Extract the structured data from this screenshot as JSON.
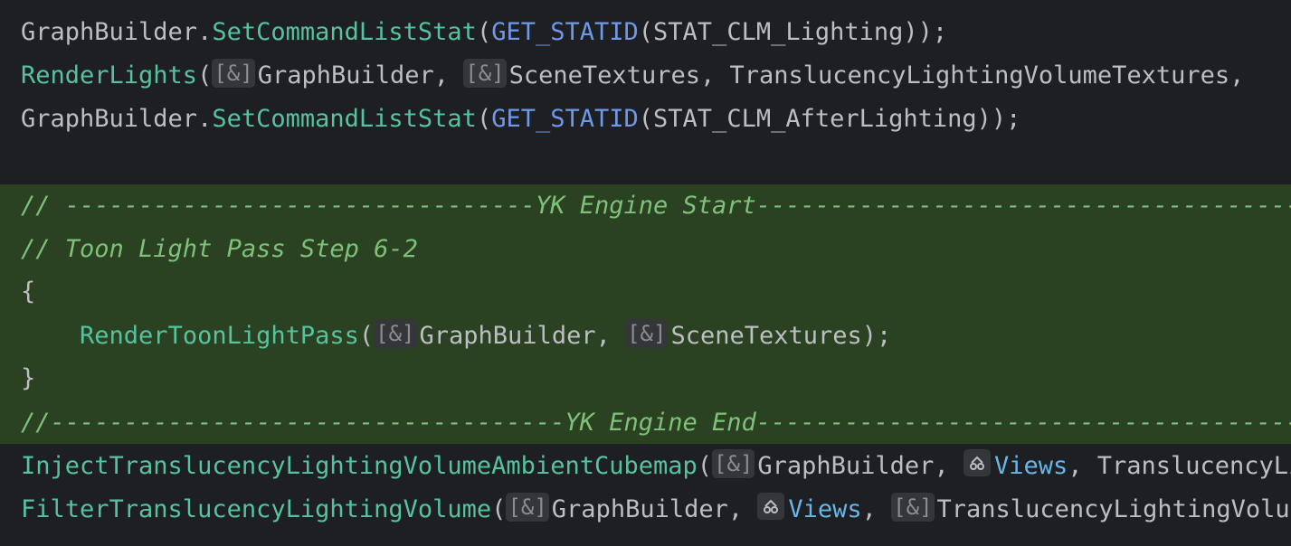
{
  "editor": {
    "lines": {
      "l1": {
        "obj": "GraphBuilder",
        "dot": ".",
        "method": "SetCommandListStat",
        "open": "(",
        "macro": "GET_STATID",
        "arg": "(STAT_CLM_Lighting));"
      },
      "l2": {
        "fn": "RenderLights",
        "open": "(",
        "hint1": "[&]",
        "arg1": "GraphBuilder, ",
        "hint2": "[&]",
        "arg2": "SceneTextures, TranslucencyLightingVolumeTextures,"
      },
      "l3": {
        "obj": "GraphBuilder",
        "dot": ".",
        "method": "SetCommandListStat",
        "open": "(",
        "macro": "GET_STATID",
        "arg": "(STAT_CLM_AfterLighting));"
      },
      "l5": {
        "comment": "// --------------------------------YK Engine Start-------------------------------------------"
      },
      "l6": {
        "comment": "// Toon Light Pass Step 6-2"
      },
      "l7": {
        "brace": "{"
      },
      "l8": {
        "indent": "    ",
        "fn": "RenderToonLightPass",
        "open": "(",
        "hint1": "[&]",
        "arg1": "GraphBuilder, ",
        "hint2": "[&]",
        "arg2": "SceneTextures);"
      },
      "l9": {
        "brace": "}"
      },
      "l10": {
        "comment": "//-----------------------------------YK Engine End------------------------------------------"
      },
      "l11": {
        "fn": "InjectTranslucencyLightingVolumeAmbientCubemap",
        "open": "(",
        "hint1": "[&]",
        "arg1": "GraphBuilder, ",
        "param": "Views",
        "arg2": ", TranslucencyLightingVolumeTextures);"
      },
      "l12": {
        "fn": "FilterTranslucencyLightingVolume",
        "open": "(",
        "hint1": "[&]",
        "arg1": "GraphBuilder, ",
        "param": "Views",
        "sep": ", ",
        "hint2": "[&]",
        "arg2": "TranslucencyLightingVolumeTextures);"
      }
    }
  },
  "colors": {
    "background": "#1e1f22",
    "highlight": "#2b4222",
    "function": "#56c2a0",
    "macro": "#6f98e8",
    "comment": "#7ec27a",
    "parameter": "#68b5e8"
  },
  "icons": {
    "mutable_param_hint": "mutable-parameter-icon"
  }
}
